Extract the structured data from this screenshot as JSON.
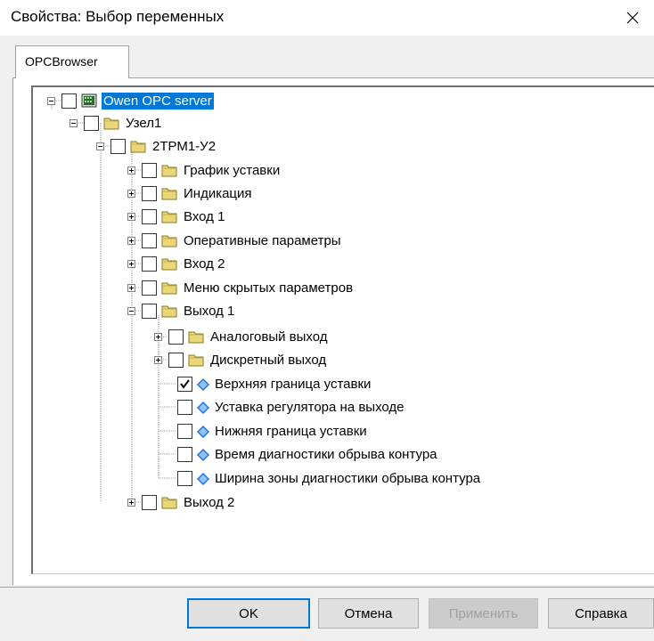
{
  "window": {
    "title": "Свойства: Выбор переменных",
    "close_glyph": "✕"
  },
  "tabs": [
    {
      "label": "OPCBrowser",
      "active": true
    }
  ],
  "tree": {
    "nodes": [
      {
        "label": "Owen OPC server",
        "icon": "server-icon",
        "expanded": true,
        "checked": false,
        "selected": true
      },
      {
        "label": "Узел1",
        "icon": "folder-icon",
        "expanded": true,
        "checked": false
      },
      {
        "label": "2ТРМ1-У2",
        "icon": "folder-icon",
        "expanded": true,
        "checked": false
      },
      {
        "label": "График уставки",
        "icon": "folder-icon",
        "expanded": false,
        "checked": false
      },
      {
        "label": "Индикация",
        "icon": "folder-icon",
        "expanded": false,
        "checked": false
      },
      {
        "label": "Вход 1",
        "icon": "folder-icon",
        "expanded": false,
        "checked": false
      },
      {
        "label": "Оперативные параметры",
        "icon": "folder-icon",
        "expanded": false,
        "checked": false
      },
      {
        "label": "Вход 2",
        "icon": "folder-icon",
        "expanded": false,
        "checked": false
      },
      {
        "label": "Меню скрытых параметров",
        "icon": "folder-icon",
        "expanded": false,
        "checked": false
      },
      {
        "label": "Выход 1",
        "icon": "folder-icon",
        "expanded": true,
        "checked": false
      },
      {
        "label": "Аналоговый выход",
        "icon": "folder-icon",
        "expanded": false,
        "checked": false
      },
      {
        "label": "Дискретный выход",
        "icon": "folder-icon",
        "expanded": false,
        "checked": false
      },
      {
        "label": "Верхняя граница уставки",
        "icon": "tag-icon",
        "checked": true
      },
      {
        "label": "Уставка регулятора на выходе",
        "icon": "tag-icon",
        "checked": false
      },
      {
        "label": "Нижняя граница уставки",
        "icon": "tag-icon",
        "checked": false
      },
      {
        "label": "Время диагностики обрыва контура",
        "icon": "tag-icon",
        "checked": false
      },
      {
        "label": "Ширина зоны диагностики обрыва контура",
        "icon": "tag-icon",
        "checked": false
      },
      {
        "label": "Выход 2",
        "icon": "folder-icon",
        "expanded": false,
        "checked": false
      }
    ]
  },
  "buttons": {
    "ok": "OK",
    "cancel": "Отмена",
    "apply": "Применить",
    "help": "Справка"
  },
  "colors": {
    "selection": "#0078d7",
    "folder": "#e9d77a",
    "tag": "#1e6fd9"
  }
}
